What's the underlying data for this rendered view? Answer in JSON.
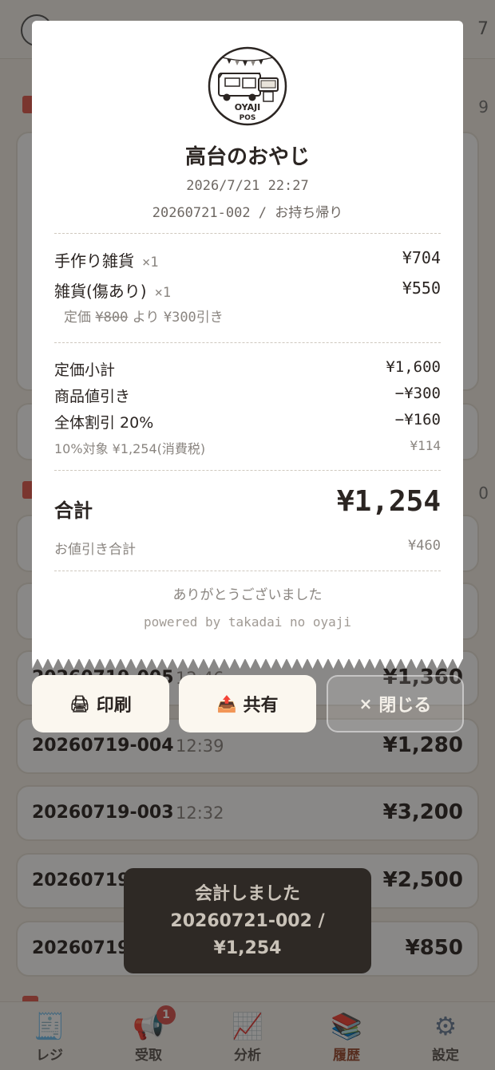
{
  "header": {
    "right_text": "7"
  },
  "background": {
    "date_groups": [
      {
        "count": "9"
      },
      {
        "count": "0"
      }
    ],
    "history": [
      {
        "id": "20260719-005",
        "time": "12:46",
        "amount": "¥1,360"
      },
      {
        "id": "20260719-004",
        "time": "12:39",
        "amount": "¥1,280"
      },
      {
        "id": "20260719-003",
        "time": "12:32",
        "amount": "¥3,200"
      },
      {
        "id": "20260719-002",
        "time": "",
        "amount": "¥2,500"
      },
      {
        "id": "20260719-001",
        "time": "",
        "amount": "¥850"
      }
    ]
  },
  "receipt": {
    "logo_text": "OYAJI POS",
    "shop_name": "高台のおやじ",
    "datetime": "2026/7/21 22:27",
    "order_line": "20260721-002 / お持ち帰り",
    "items": [
      {
        "name": "手作り雑貨",
        "qty": "×1",
        "price": "¥704"
      },
      {
        "name": "雑貨(傷あり)",
        "qty": "×1",
        "price": "¥550"
      }
    ],
    "discount_note": {
      "prefix": "定価",
      "original": "¥800",
      "middle": "より",
      "amount": "¥300引き"
    },
    "subtotal_label": "定価小計",
    "subtotal_value": "¥1,600",
    "item_discount_label": "商品値引き",
    "item_discount_value": "−¥300",
    "overall_discount_label": "全体割引 20%",
    "overall_discount_value": "−¥160",
    "tax_label": "10%対象 ¥1,254(消費税)",
    "tax_value": "¥114",
    "total_label": "合計",
    "total_value": "¥1,254",
    "discount_total_label": "お値引き合計",
    "discount_total_value": "¥460",
    "thanks": "ありがとうございました",
    "powered_by": "powered by takadai no oyaji"
  },
  "actions": {
    "print": {
      "icon": "🖨",
      "label": "印刷"
    },
    "share": {
      "icon": "📤",
      "label": "共有"
    },
    "close": {
      "icon": "×",
      "label": "閉じる"
    }
  },
  "toast": {
    "line1": "会計しました",
    "line2": "20260721-002 /",
    "line3": "¥1,254"
  },
  "tabbar": {
    "tabs": [
      {
        "icon": "receipt-icon",
        "label": "レジ"
      },
      {
        "icon": "megaphone-icon",
        "label": "受取",
        "badge": "1"
      },
      {
        "icon": "chart-icon",
        "label": "分析"
      },
      {
        "icon": "books-icon",
        "label": "履歴"
      },
      {
        "icon": "gear-icon",
        "label": "設定"
      }
    ],
    "active_tab": "履歴"
  },
  "colors": {
    "accent": "#9a4b30",
    "overlay": "#14121080",
    "badge": "#d9534f"
  }
}
